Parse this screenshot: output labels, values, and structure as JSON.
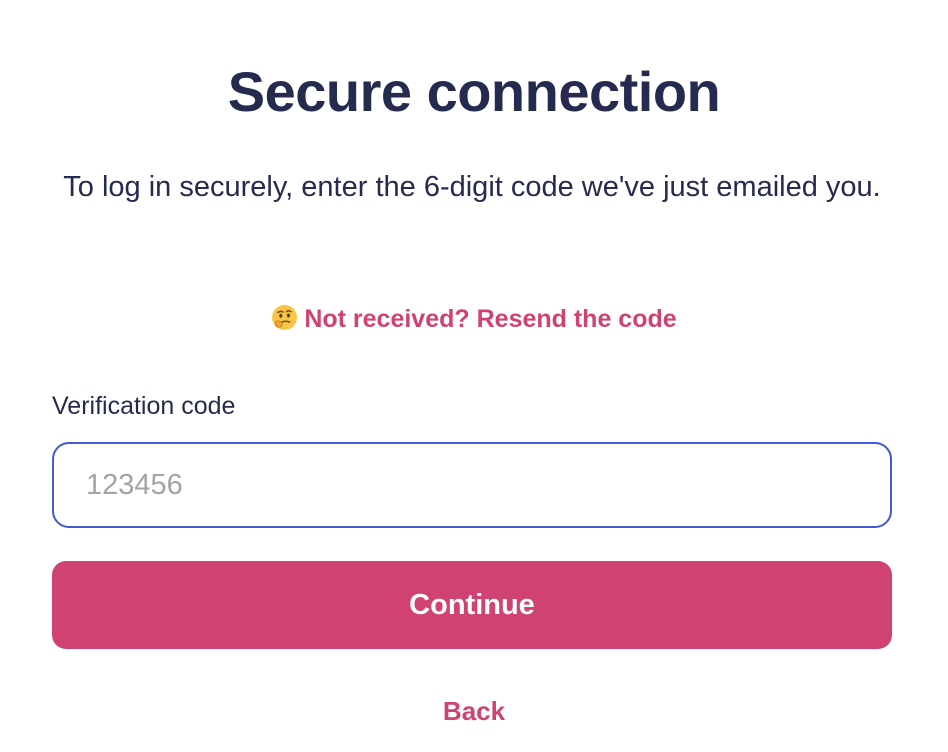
{
  "title": "Secure connection",
  "description": "To log in securely, enter the 6-digit code we've just emailed you.",
  "resend": {
    "icon": "thinking-face-icon",
    "label": "Not received? Resend the code"
  },
  "verification": {
    "label": "Verification code",
    "placeholder": "123456",
    "value": ""
  },
  "continue_label": "Continue",
  "back_label": "Back",
  "colors": {
    "heading": "#252b4e",
    "accent": "#cf4272",
    "input_border": "#4559d6",
    "placeholder": "#a3a3a8"
  }
}
